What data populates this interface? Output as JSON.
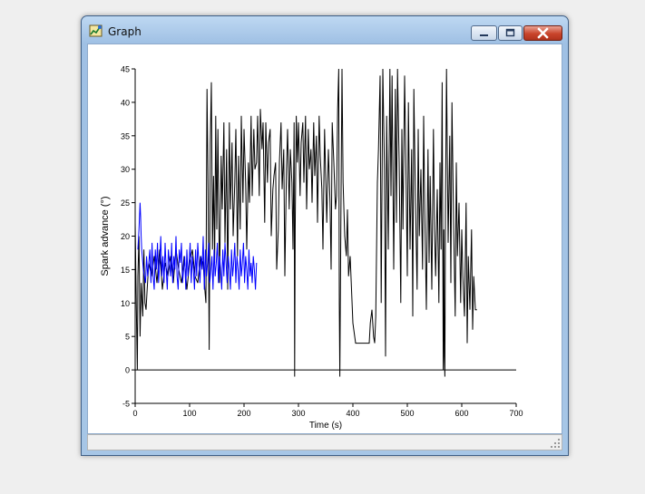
{
  "window": {
    "title": "Graph",
    "app_icon": "graph-app-icon"
  },
  "controls": {
    "minimize": "minimize-icon",
    "maximize": "maximize-icon",
    "close": "close-icon"
  },
  "chart_data": {
    "type": "line",
    "title": "",
    "xlabel": "Time (s)",
    "ylabel": "Spark advance (°)",
    "xlim": [
      0,
      700
    ],
    "ylim": [
      -5,
      45
    ],
    "xticks": [
      0,
      100,
      200,
      300,
      400,
      500,
      600,
      700
    ],
    "yticks": [
      -5,
      0,
      5,
      10,
      15,
      20,
      25,
      30,
      35,
      40,
      45
    ],
    "grid": false,
    "reference_line": {
      "y": 0,
      "x_range": [
        0,
        700
      ],
      "color": "#000000"
    },
    "series": [
      {
        "color": "#000000",
        "x": [
          0,
          2,
          4,
          5,
          7,
          9,
          11,
          14,
          16,
          18,
          20,
          22,
          25,
          30,
          35,
          40,
          45,
          50,
          55,
          60,
          65,
          70,
          75,
          80,
          85,
          90,
          95,
          100,
          105,
          110,
          115,
          120,
          125,
          128,
          130,
          132,
          134,
          136,
          138,
          140,
          142,
          144,
          146,
          148,
          150,
          152,
          155,
          158,
          160,
          163,
          165,
          168,
          170,
          173,
          175,
          178,
          180,
          183,
          185,
          188,
          190,
          193,
          195,
          198,
          200,
          203,
          205,
          208,
          210,
          213,
          215,
          218,
          220,
          223,
          225,
          228,
          230,
          233,
          235,
          238,
          240,
          243,
          245,
          248,
          250,
          253,
          255,
          258,
          260,
          263,
          265,
          268,
          270,
          273,
          275,
          278,
          280,
          283,
          285,
          288,
          290,
          292,
          293,
          294,
          295,
          296,
          298,
          300,
          303,
          305,
          308,
          310,
          313,
          315,
          318,
          320,
          323,
          325,
          328,
          330,
          333,
          335,
          338,
          340,
          343,
          345,
          348,
          350,
          352,
          355,
          358,
          360,
          362,
          365,
          368,
          370,
          372,
          374,
          375,
          376,
          378,
          380,
          382,
          385,
          388,
          390,
          392,
          395,
          398,
          400,
          405,
          410,
          415,
          420,
          425,
          430,
          432,
          435,
          438,
          440,
          442,
          445,
          447,
          450,
          452,
          455,
          458,
          460,
          462,
          465,
          468,
          470,
          472,
          475,
          478,
          480,
          482,
          485,
          488,
          490,
          492,
          495,
          498,
          500,
          502,
          505,
          508,
          510,
          512,
          515,
          518,
          520,
          522,
          525,
          528,
          530,
          532,
          535,
          538,
          540,
          542,
          545,
          548,
          550,
          552,
          555,
          558,
          560,
          562,
          564,
          566,
          567,
          568,
          569,
          570,
          572,
          575,
          578,
          580,
          582,
          585,
          588,
          590,
          592,
          595,
          598,
          600,
          602,
          605,
          608,
          610,
          612,
          615,
          618,
          620,
          622,
          625,
          628
        ],
        "y": [
          22,
          10,
          0,
          14,
          20,
          5,
          13,
          8,
          18,
          10,
          9,
          12,
          16,
          14,
          17,
          13,
          18,
          12,
          16,
          14,
          17,
          13,
          18,
          15,
          13,
          17,
          12,
          16,
          18,
          14,
          13,
          17,
          16,
          12,
          10,
          42,
          27,
          3,
          34,
          43,
          18,
          29,
          16,
          38,
          21,
          36,
          13,
          32,
          24,
          37,
          19,
          33,
          12,
          37,
          24,
          34,
          20,
          28,
          36,
          17,
          32,
          21,
          38,
          25,
          36,
          28,
          18,
          31,
          25,
          38,
          26,
          36,
          30,
          31,
          38,
          26,
          39,
          33,
          37,
          22,
          37,
          28,
          34,
          36,
          20,
          27,
          29,
          31,
          15,
          21,
          31,
          37,
          27,
          33,
          14,
          30,
          36,
          24,
          33,
          28,
          18,
          37,
          -1,
          21,
          30,
          38,
          31,
          37,
          26,
          34,
          37,
          28,
          38,
          24,
          36,
          30,
          33,
          25,
          37,
          29,
          35,
          22,
          38,
          32,
          27,
          18,
          36,
          29,
          22,
          33,
          25,
          15,
          37,
          31,
          24,
          26,
          39,
          45,
          10,
          -1,
          23,
          45,
          28,
          20,
          17,
          24,
          14,
          17,
          11,
          7,
          4,
          4,
          4,
          4,
          4,
          4,
          7,
          9,
          5,
          4,
          8,
          28,
          33,
          44,
          10,
          45,
          30,
          2,
          38,
          18,
          45,
          26,
          44,
          15,
          42,
          22,
          45,
          31,
          10,
          36,
          21,
          44,
          27,
          14,
          40,
          18,
          33,
          8,
          42,
          25,
          12,
          36,
          20,
          30,
          15,
          38,
          24,
          9,
          33,
          16,
          29,
          12,
          36,
          21,
          14,
          27,
          10,
          31,
          18,
          43,
          0,
          21,
          2,
          -1,
          23,
          45,
          19,
          35,
          13,
          40,
          22,
          8,
          31,
          17,
          25,
          10,
          21,
          14,
          8,
          25,
          4,
          17,
          9,
          21,
          6,
          14,
          9,
          9
        ]
      },
      {
        "color": "#0000ff",
        "x": [
          5,
          7,
          9,
          10,
          11,
          12,
          13,
          14,
          15,
          17,
          19,
          21,
          23,
          25,
          27,
          29,
          31,
          33,
          35,
          37,
          39,
          41,
          43,
          45,
          47,
          49,
          51,
          53,
          55,
          57,
          59,
          61,
          63,
          65,
          67,
          69,
          71,
          73,
          75,
          77,
          79,
          81,
          83,
          85,
          87,
          89,
          91,
          93,
          95,
          97,
          99,
          101,
          103,
          105,
          107,
          109,
          111,
          113,
          115,
          117,
          119,
          121,
          123,
          125,
          127,
          129,
          131,
          133,
          135,
          137,
          139,
          141,
          143,
          145,
          147,
          149,
          151,
          153,
          155,
          157,
          159,
          161,
          163,
          165,
          167,
          169,
          171,
          173,
          175,
          177,
          179,
          181,
          183,
          185,
          187,
          189,
          191,
          193,
          195,
          197,
          199,
          201,
          203,
          205,
          207,
          209,
          211,
          213,
          215,
          217,
          219,
          221,
          223
        ],
        "y": [
          18,
          21,
          25,
          23,
          20,
          18,
          17,
          16,
          15,
          14,
          13,
          17,
          14,
          16,
          18,
          13,
          19,
          14,
          12,
          18,
          15,
          19,
          13,
          16,
          20,
          14,
          17,
          13,
          19,
          15,
          12,
          18,
          16,
          14,
          19,
          13,
          17,
          15,
          20,
          14,
          12,
          18,
          16,
          19,
          13,
          15,
          17,
          12,
          18,
          14,
          16,
          19,
          13,
          17,
          15,
          12,
          18,
          14,
          19,
          16,
          13,
          17,
          15,
          20,
          12,
          18,
          14,
          16,
          19,
          13,
          15,
          17,
          12,
          18,
          14,
          16,
          19,
          13,
          17,
          15,
          12,
          18,
          14,
          19,
          16,
          13,
          17,
          15,
          12,
          18,
          14,
          16,
          19,
          13,
          17,
          15,
          12,
          18,
          14,
          16,
          19,
          13,
          17,
          15,
          12,
          18,
          14,
          16,
          13,
          17,
          15,
          12,
          16
        ]
      }
    ]
  }
}
